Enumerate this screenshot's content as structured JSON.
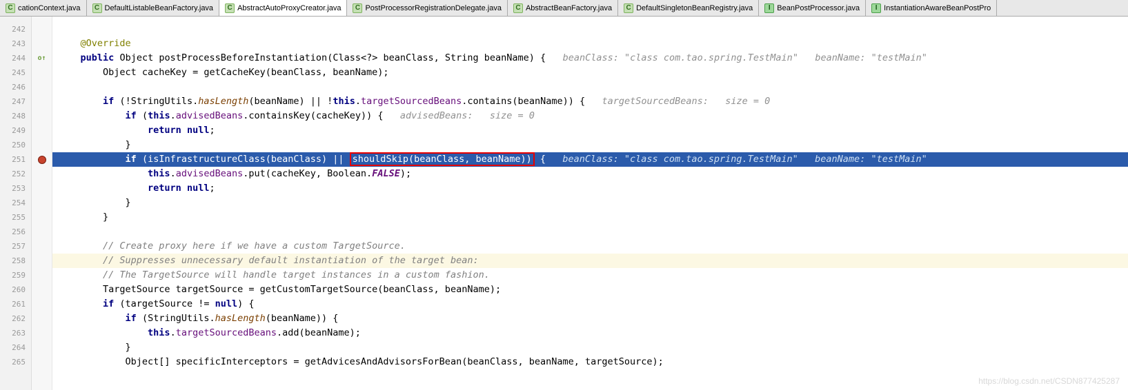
{
  "tabs": [
    {
      "label": "cationContext.java",
      "icon": "c",
      "active": false
    },
    {
      "label": "DefaultListableBeanFactory.java",
      "icon": "c",
      "active": false
    },
    {
      "label": "AbstractAutoProxyCreator.java",
      "icon": "c",
      "active": true
    },
    {
      "label": "PostProcessorRegistrationDelegate.java",
      "icon": "c",
      "active": false
    },
    {
      "label": "AbstractBeanFactory.java",
      "icon": "c",
      "active": false
    },
    {
      "label": "DefaultSingletonBeanRegistry.java",
      "icon": "c",
      "active": false
    },
    {
      "label": "BeanPostProcessor.java",
      "icon": "i",
      "active": false
    },
    {
      "label": "InstantiationAwareBeanPostPro",
      "icon": "i",
      "active": false
    }
  ],
  "gutter": [
    "242",
    "243",
    "244",
    "245",
    "246",
    "247",
    "248",
    "249",
    "250",
    "251",
    "252",
    "253",
    "254",
    "255",
    "256",
    "257",
    "258",
    "259",
    "260",
    "261",
    "262",
    "263",
    "264",
    "265"
  ],
  "code": {
    "l243_ann": "@Override",
    "l244_kw_public": "public",
    "l244_type": "Object",
    "l244_name": "postProcessBeforeInstantiation",
    "l244_params": "(Class<?> beanClass, String beanName) {",
    "l244_hint": "beanClass: \"class com.tao.spring.TestMain\"   beanName: \"testMain\"",
    "l245": "        Object cacheKey = getCacheKey(beanClass, beanName);",
    "l247_if": "if",
    "l247_not": "!StringUtils.",
    "l247_has": "hasLength",
    "l247_rest": "(beanName) || !",
    "l247_this": "this",
    "l247_dot": ".",
    "l247_tsb": "targetSourcedBeans",
    "l247_contains": ".contains(beanName)) {",
    "l247_hint": "targetSourcedBeans:   size = 0",
    "l248_if": "if",
    "l248_open": " (",
    "l248_this": "this",
    "l248_dot": ".",
    "l248_ab": "advisedBeans",
    "l248_rest": ".containsKey(cacheKey)) {",
    "l248_hint": "advisedBeans:   size = 0",
    "l249_ret": "return null",
    "l249_semi": ";",
    "l250": "            }",
    "l251_if": "if",
    "l251_a": " (isInfrastructureClass(beanClass) || ",
    "l251_box": "shouldSkip(beanClass, beanName))",
    "l251_b": " {",
    "l251_hint": "beanClass: \"class com.tao.spring.TestMain\"   beanName: \"testMain\"",
    "l252_this": "this",
    "l252_dot": ".",
    "l252_ab": "advisedBeans",
    "l252_put": ".put(cacheKey, Boolean.",
    "l252_false": "FALSE",
    "l252_end": ");",
    "l253_ret": "return null",
    "l253_semi": ";",
    "l254": "            }",
    "l255": "        }",
    "l257": "// Create proxy here if we have a custom TargetSource.",
    "l258": "// Suppresses unnecessary default instantiation of the target bean:",
    "l259": "// The TargetSource will handle target instances in a custom fashion.",
    "l260": "        TargetSource targetSource = getCustomTargetSource(beanClass, beanName);",
    "l261_if": "if",
    "l261_rest": " (targetSource != ",
    "l261_null": "null",
    "l261_end": ") {",
    "l262_if": "if",
    "l262_a": " (StringUtils.",
    "l262_has": "hasLength",
    "l262_b": "(beanName)) {",
    "l263_this": "this",
    "l263_dot": ".",
    "l263_tsb": "targetSourcedBeans",
    "l263_add": ".add(beanName);",
    "l264": "            }",
    "l265": "            Object[] specificInterceptors = getAdvicesAndAdvisorsForBean(beanClass, beanName, targetSource);"
  },
  "watermark": "https://blog.csdn.net/CSDN877425287"
}
